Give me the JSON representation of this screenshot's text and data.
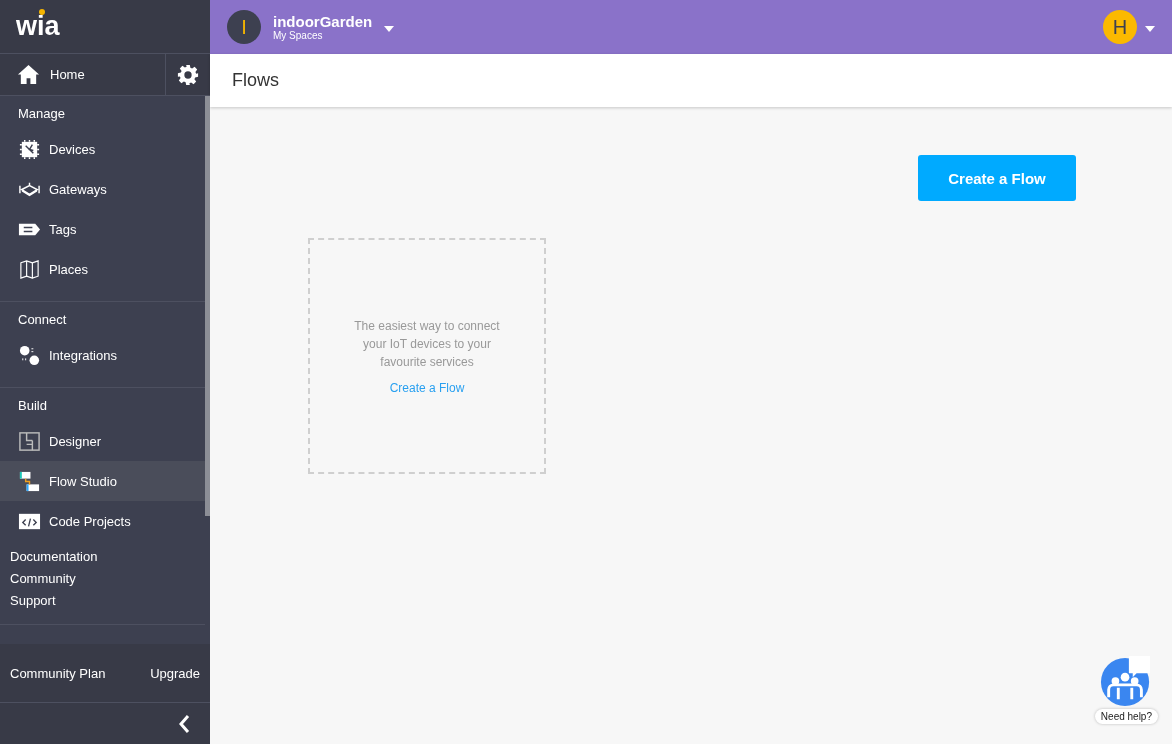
{
  "sidebar": {
    "logo": "wia",
    "home": {
      "label": "Home"
    },
    "sections": [
      {
        "title": "Manage",
        "items": [
          {
            "label": "Devices",
            "selected": false
          },
          {
            "label": "Gateways",
            "selected": false
          },
          {
            "label": "Tags",
            "selected": false
          },
          {
            "label": "Places",
            "selected": false
          }
        ]
      },
      {
        "title": "Connect",
        "items": [
          {
            "label": "Integrations",
            "selected": false
          }
        ]
      },
      {
        "title": "Build",
        "items": [
          {
            "label": "Designer",
            "selected": false
          },
          {
            "label": "Flow Studio",
            "selected": true
          },
          {
            "label": "Code Projects",
            "selected": false
          }
        ]
      }
    ],
    "links": [
      "Documentation",
      "Community",
      "Support"
    ],
    "plan": {
      "label": "Community Plan",
      "action": "Upgrade"
    }
  },
  "header": {
    "space_initial": "I",
    "space_name": "indoorGarden",
    "space_caption": "My Spaces",
    "user_initial": "H"
  },
  "page": {
    "title": "Flows",
    "create_button": "Create a Flow",
    "empty_card": {
      "text": "The easiest way to connect your IoT devices to your favourite services",
      "link": "Create a Flow"
    }
  },
  "help_widget": {
    "label": "Need help?"
  }
}
